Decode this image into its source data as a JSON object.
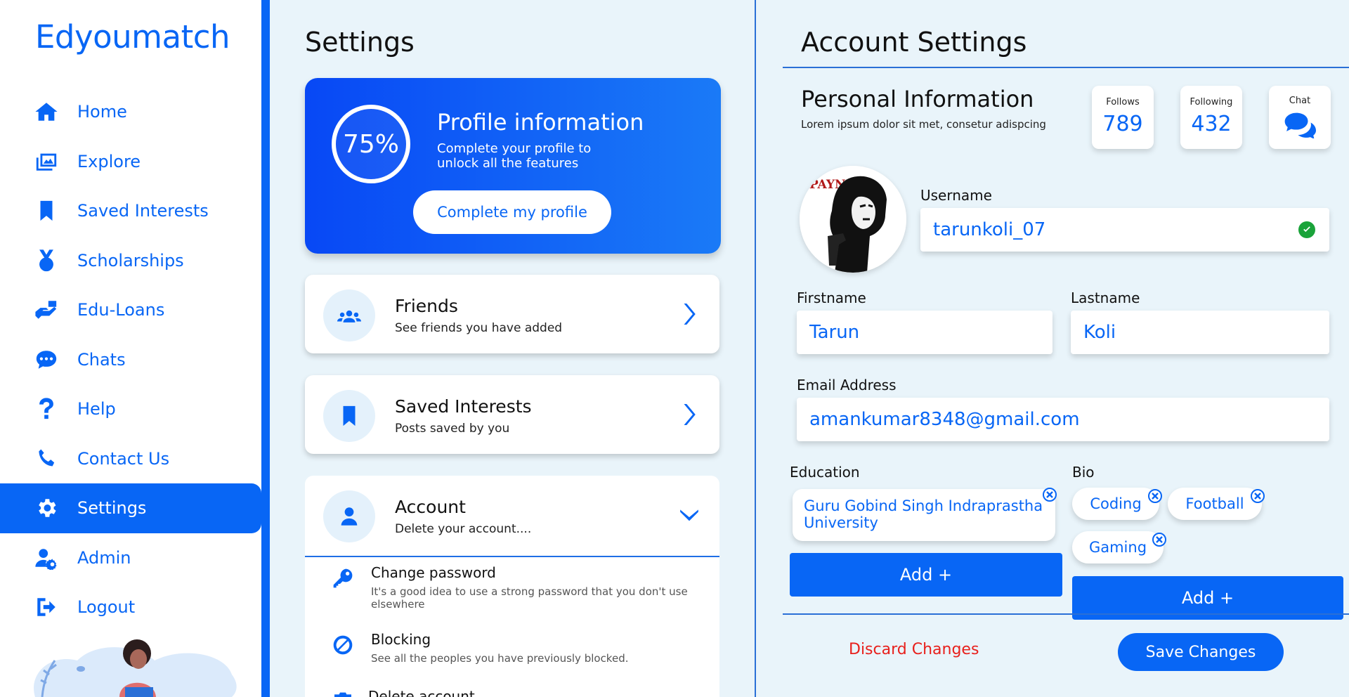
{
  "brand": "Edyoumatch",
  "sidebar": {
    "items": [
      {
        "label": "Home",
        "icon": "home-icon"
      },
      {
        "label": "Explore",
        "icon": "images-icon"
      },
      {
        "label": "Saved Interests",
        "icon": "bookmark-icon"
      },
      {
        "label": "Scholarships",
        "icon": "medal-icon"
      },
      {
        "label": "Edu-Loans",
        "icon": "hand-money-icon"
      },
      {
        "label": "Chats",
        "icon": "chat-icon"
      },
      {
        "label": "Help",
        "icon": "question-icon"
      },
      {
        "label": "Contact Us",
        "icon": "phone-icon"
      },
      {
        "label": "Settings",
        "icon": "gear-icon",
        "active": true
      },
      {
        "label": "Admin",
        "icon": "user-cog-icon"
      },
      {
        "label": "Logout",
        "icon": "logout-icon"
      }
    ]
  },
  "settings": {
    "title": "Settings",
    "profile_card": {
      "percent": "75%",
      "title": "Profile information",
      "subtitle": "Complete your profile to unlock all the features",
      "button": "Complete my profile"
    },
    "friends": {
      "title": "Friends",
      "subtitle": "See friends you have added"
    },
    "saved": {
      "title": "Saved Interests",
      "subtitle": "Posts saved by you"
    },
    "account": {
      "title": "Account",
      "subtitle": "Delete your account....",
      "options": [
        {
          "title": "Change password",
          "subtitle": "It's a good idea to use a strong password that you don't use elsewhere"
        },
        {
          "title": "Blocking",
          "subtitle": "See all the peoples you have previously blocked."
        },
        {
          "title": "Delete account",
          "subtitle": ""
        }
      ]
    }
  },
  "account_settings": {
    "title": "Account Settings",
    "personal": {
      "title": "Personal Information",
      "subtitle": "Lorem ipsum dolor sit met, consetur adispcing"
    },
    "stats": {
      "follows_label": "Follows",
      "follows_value": "789",
      "following_label": "Following",
      "following_value": "432",
      "chat_label": "Chat"
    },
    "avatar_text": "PAYNE",
    "username_label": "Username",
    "username": "tarunkoli_07",
    "firstname_label": "Firstname",
    "firstname": "Tarun",
    "lastname_label": "Lastname",
    "lastname": "Koli",
    "email_label": "Email Address",
    "email": "amankumar8348@gmail.com",
    "education_label": "Education",
    "education": [
      "Guru Gobind Singh Indraprastha University"
    ],
    "bio_label": "Bio",
    "bio_tags": [
      "Coding",
      "Football",
      "Gaming"
    ],
    "add_label": "Add +",
    "discard": "Discard Changes",
    "save": "Save Changes"
  },
  "colors": {
    "accent": "#0866f5",
    "danger": "#e8201c",
    "success": "#1aa33a",
    "background": "#e9f4fa"
  }
}
